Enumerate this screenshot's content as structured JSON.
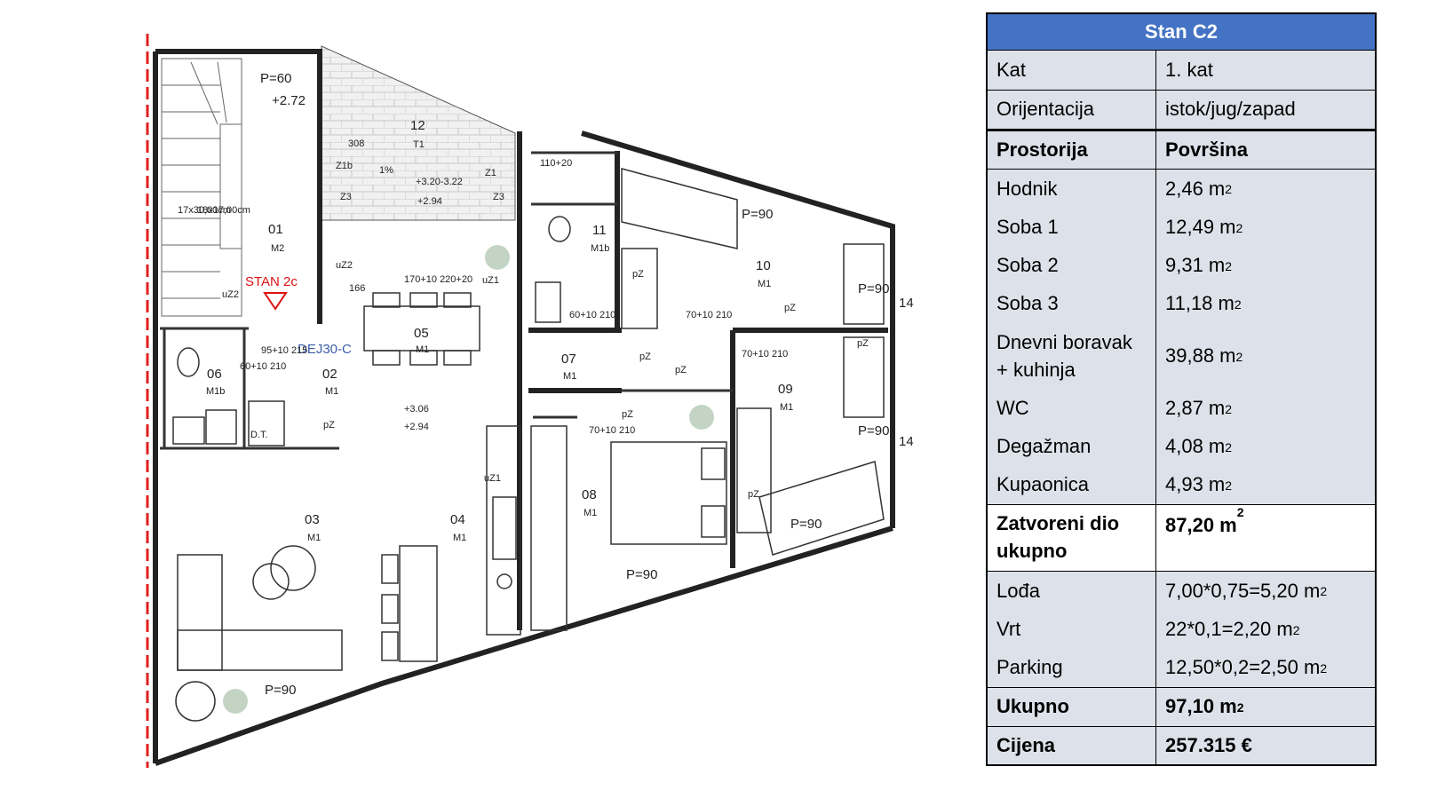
{
  "table": {
    "title": "Stan C2",
    "info": [
      {
        "label": "Kat",
        "value": "1. kat"
      },
      {
        "label": "Orijentacija",
        "value": "istok/jug/zapad"
      }
    ],
    "header": {
      "label": "Prostorija",
      "value": "Površina"
    },
    "rooms": [
      {
        "label": "Hodnik",
        "value": "2,46 m"
      },
      {
        "label": "Soba 1",
        "value": "12,49 m"
      },
      {
        "label": "Soba 2",
        "value": "9,31 m"
      },
      {
        "label": "Soba 3",
        "value": "11,18 m"
      },
      {
        "label": "Dnevni boravak + kuhinja",
        "value": "39,88 m"
      },
      {
        "label": "WC",
        "value": "2,87 m"
      },
      {
        "label": "Degažman",
        "value": "4,08 m"
      },
      {
        "label": "Kupaonica",
        "value": "4,93 m"
      }
    ],
    "closed_total": {
      "label": "Zatvoreni dio ukupno",
      "value": "87,20 m"
    },
    "extras": [
      {
        "label": "Lođa",
        "value": "7,00*0,75=5,20 m"
      },
      {
        "label": "Vrt",
        "value": "22*0,1=2,20 m"
      },
      {
        "label": "Parking",
        "value": "12,50*0,2=2,50 m"
      }
    ],
    "total": {
      "label": "Ukupno",
      "value": "97,10 m"
    },
    "price": {
      "label": "Cijena",
      "value": "257.315 €"
    },
    "unit_sup": "2"
  },
  "plan": {
    "unit_label": "STAN 2c",
    "door_label": "DEJ30-C",
    "rooms": [
      {
        "num": "01",
        "code": "M2"
      },
      {
        "num": "02",
        "code": "M1"
      },
      {
        "num": "03",
        "code": "M1"
      },
      {
        "num": "04",
        "code": "M1"
      },
      {
        "num": "05",
        "code": "M1"
      },
      {
        "num": "06",
        "code": "M1b"
      },
      {
        "num": "07",
        "code": "M1"
      },
      {
        "num": "08",
        "code": "M1"
      },
      {
        "num": "09",
        "code": "M1"
      },
      {
        "num": "10",
        "code": "M1"
      },
      {
        "num": "11",
        "code": "M1b"
      },
      {
        "num": "12",
        "code": "T1"
      }
    ],
    "annotations": {
      "p60": "P=60",
      "lvl272": "+2.72",
      "lvl320": "+3.20-3.22",
      "lvl294a": "+2.94",
      "lvl306": "+3.06",
      "lvl294b": "+2.94",
      "slope": "1%",
      "d308": "308",
      "d110": "110+20",
      "d166": "166",
      "d170_220": "170+10 220+20",
      "d60_210": "60+10 210",
      "d70_210a": "70+10 210",
      "d70_210b": "70+10 210",
      "d95_215": "95+10 215",
      "d60_210b": "60+10 210",
      "d70_210c": "70+10 210",
      "p90": "P=90",
      "dt": "D.T.",
      "stairs1": "17x30,00cm",
      "stairs2": "18x17,00cm",
      "n14a": "14",
      "n14b": "14"
    },
    "tags": [
      "Z1b",
      "Z1",
      "Z3",
      "Z3",
      "uZ2",
      "uZ2",
      "uZ1",
      "uZ1",
      "pZ",
      "pZ",
      "pZ",
      "pZ",
      "pZ",
      "pZ",
      "pZ",
      "pZ"
    ]
  }
}
